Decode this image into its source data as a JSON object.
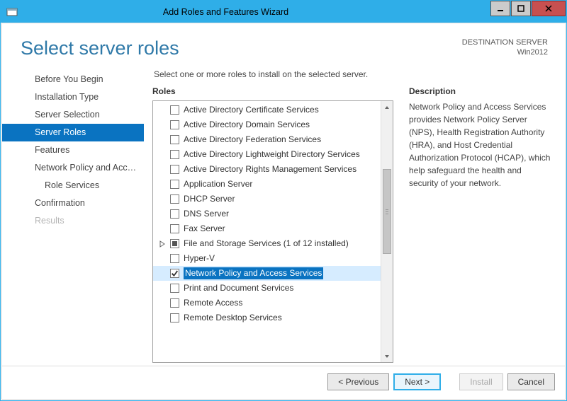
{
  "window": {
    "title": "Add Roles and Features Wizard"
  },
  "header": {
    "title": "Select server roles",
    "destination_label": "DESTINATION SERVER",
    "destination_value": "Win2012"
  },
  "sidebar": {
    "items": [
      {
        "label": "Before You Begin",
        "active": false
      },
      {
        "label": "Installation Type",
        "active": false
      },
      {
        "label": "Server Selection",
        "active": false
      },
      {
        "label": "Server Roles",
        "active": true
      },
      {
        "label": "Features",
        "active": false
      },
      {
        "label": "Network Policy and Acces...",
        "active": false
      },
      {
        "label": "Role Services",
        "active": false,
        "indent": true
      },
      {
        "label": "Confirmation",
        "active": false
      },
      {
        "label": "Results",
        "active": false,
        "disabled": true
      }
    ]
  },
  "main": {
    "instruction": "Select one or more roles to install on the selected server.",
    "roles_label": "Roles",
    "roles": [
      {
        "label": "Active Directory Certificate Services",
        "state": "unchecked"
      },
      {
        "label": "Active Directory Domain Services",
        "state": "unchecked"
      },
      {
        "label": "Active Directory Federation Services",
        "state": "unchecked"
      },
      {
        "label": "Active Directory Lightweight Directory Services",
        "state": "unchecked"
      },
      {
        "label": "Active Directory Rights Management Services",
        "state": "unchecked"
      },
      {
        "label": "Application Server",
        "state": "unchecked"
      },
      {
        "label": "DHCP Server",
        "state": "unchecked"
      },
      {
        "label": "DNS Server",
        "state": "unchecked"
      },
      {
        "label": "Fax Server",
        "state": "unchecked"
      },
      {
        "label": "File and Storage Services (1 of 12 installed)",
        "state": "partial",
        "expander": true
      },
      {
        "label": "Hyper-V",
        "state": "unchecked"
      },
      {
        "label": "Network Policy and Access Services",
        "state": "checked",
        "selected": true
      },
      {
        "label": "Print and Document Services",
        "state": "unchecked"
      },
      {
        "label": "Remote Access",
        "state": "unchecked"
      },
      {
        "label": "Remote Desktop Services",
        "state": "unchecked"
      }
    ],
    "description_label": "Description",
    "description_body": "Network Policy and Access Services provides Network Policy Server (NPS), Health Registration Authority (HRA), and Host Credential Authorization Protocol (HCAP), which help safeguard the health and security of your network."
  },
  "footer": {
    "previous": "< Previous",
    "next": "Next >",
    "install": "Install",
    "cancel": "Cancel"
  }
}
